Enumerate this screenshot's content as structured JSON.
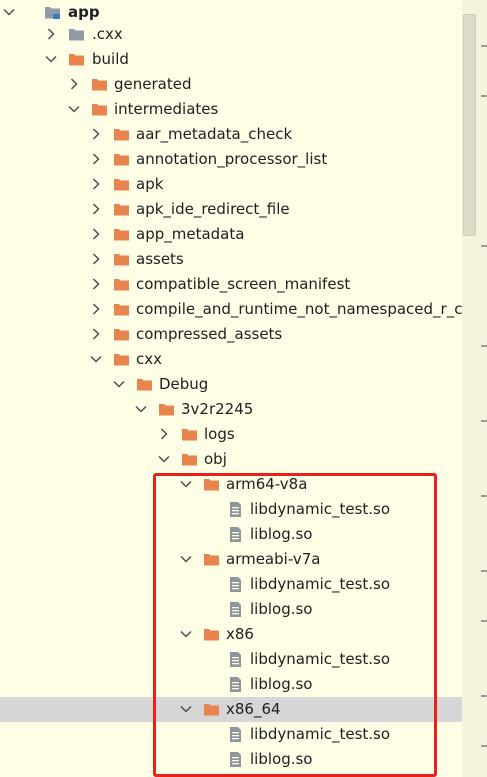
{
  "tree": {
    "rows": [
      {
        "label": "app",
        "expanded": true,
        "icon": "module-folder-icon",
        "bold": true
      },
      {
        "label": ".cxx",
        "expanded": false,
        "icon": "folder-icon-gray"
      },
      {
        "label": "build",
        "expanded": true,
        "icon": "folder-icon"
      },
      {
        "label": "generated",
        "expanded": false,
        "icon": "folder-icon"
      },
      {
        "label": "intermediates",
        "expanded": true,
        "icon": "folder-icon"
      },
      {
        "label": "aar_metadata_check",
        "expanded": false,
        "icon": "folder-icon"
      },
      {
        "label": "annotation_processor_list",
        "expanded": false,
        "icon": "folder-icon"
      },
      {
        "label": "apk",
        "expanded": false,
        "icon": "folder-icon"
      },
      {
        "label": "apk_ide_redirect_file",
        "expanded": false,
        "icon": "folder-icon"
      },
      {
        "label": "app_metadata",
        "expanded": false,
        "icon": "folder-icon"
      },
      {
        "label": "assets",
        "expanded": false,
        "icon": "folder-icon"
      },
      {
        "label": "compatible_screen_manifest",
        "expanded": false,
        "icon": "folder-icon"
      },
      {
        "label": "compile_and_runtime_not_namespaced_r_class",
        "expanded": false,
        "icon": "folder-icon"
      },
      {
        "label": "compressed_assets",
        "expanded": false,
        "icon": "folder-icon"
      },
      {
        "label": "cxx",
        "expanded": true,
        "icon": "folder-icon"
      },
      {
        "label": "Debug",
        "expanded": true,
        "icon": "folder-icon"
      },
      {
        "label": "3v2r2245",
        "expanded": true,
        "icon": "folder-icon"
      },
      {
        "label": "logs",
        "expanded": false,
        "icon": "folder-icon"
      },
      {
        "label": "obj",
        "expanded": true,
        "icon": "folder-icon"
      },
      {
        "label": "arm64-v8a",
        "expanded": true,
        "icon": "folder-icon"
      },
      {
        "label": "libdynamic_test.so",
        "icon": "file-icon"
      },
      {
        "label": "liblog.so",
        "icon": "file-icon"
      },
      {
        "label": "armeabi-v7a",
        "expanded": true,
        "icon": "folder-icon"
      },
      {
        "label": "libdynamic_test.so",
        "icon": "file-icon"
      },
      {
        "label": "liblog.so",
        "icon": "file-icon"
      },
      {
        "label": "x86",
        "expanded": true,
        "icon": "folder-icon"
      },
      {
        "label": "libdynamic_test.so",
        "icon": "file-icon"
      },
      {
        "label": "liblog.so",
        "icon": "file-icon"
      },
      {
        "label": "x86_64",
        "expanded": true,
        "icon": "folder-icon",
        "selected": true
      },
      {
        "label": "libdynamic_test.so",
        "icon": "file-icon"
      },
      {
        "label": "liblog.so",
        "icon": "file-icon"
      }
    ]
  },
  "colors": {
    "background": "#fefde6",
    "selection": "#d6d6d6",
    "folder": "#e8854e",
    "folder_gray": "#8f9aa6",
    "file": "#8f959c",
    "highlight_border": "#e8211b",
    "arrow": "#505050"
  }
}
